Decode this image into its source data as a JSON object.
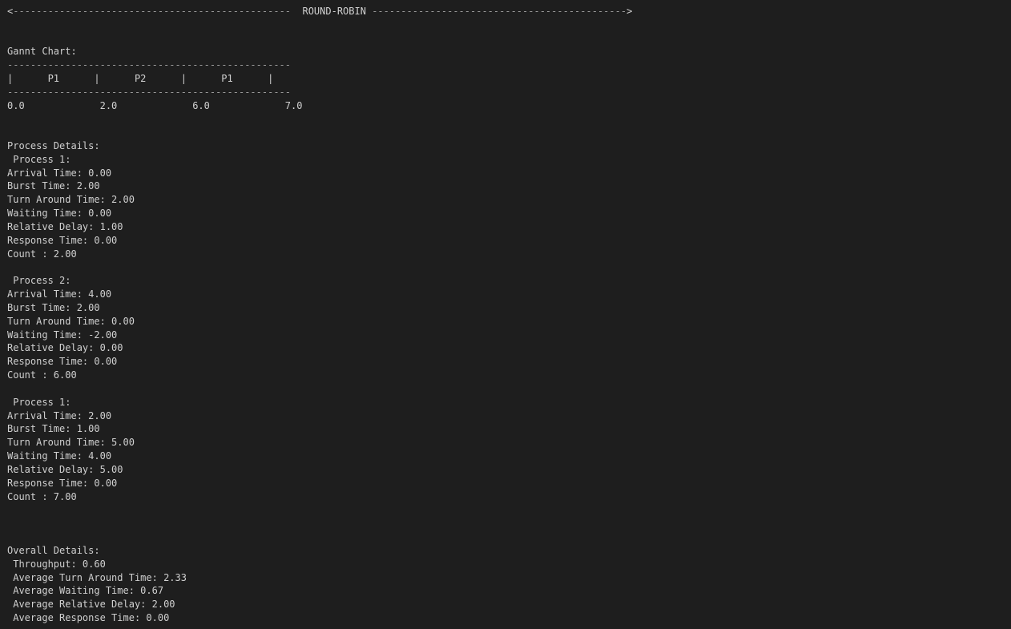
{
  "header": {
    "left_arrow": "<",
    "left_dashes": "------------------------------------------------",
    "title": "ROUND-ROBIN",
    "right_dashes": "--------------------------------------------",
    "right_arrow": ">"
  },
  "gantt": {
    "label": "Gannt Chart:",
    "border_top": "-------------------------------------------------",
    "bar_row": "|      P1      |      P2      |      P1      |",
    "border_bottom": "-------------------------------------------------",
    "times_row": "0.0             2.0             6.0             7.0"
  },
  "process_details": {
    "label": "Process Details:",
    "processes": [
      {
        "heading": " Process 1:",
        "arrival": "Arrival Time: 0.00",
        "burst": "Burst Time: 2.00",
        "turnaround": "Turn Around Time: 2.00",
        "waiting": "Waiting Time: 0.00",
        "relative_delay": "Relative Delay: 1.00",
        "response": "Response Time: 0.00",
        "count": "Count : 2.00"
      },
      {
        "heading": " Process 2:",
        "arrival": "Arrival Time: 4.00",
        "burst": "Burst Time: 2.00",
        "turnaround": "Turn Around Time: 0.00",
        "waiting": "Waiting Time: -2.00",
        "relative_delay": "Relative Delay: 0.00",
        "response": "Response Time: 0.00",
        "count": "Count : 6.00"
      },
      {
        "heading": " Process 1:",
        "arrival": "Arrival Time: 2.00",
        "burst": "Burst Time: 1.00",
        "turnaround": "Turn Around Time: 5.00",
        "waiting": "Waiting Time: 4.00",
        "relative_delay": "Relative Delay: 5.00",
        "response": "Response Time: 0.00",
        "count": "Count : 7.00"
      }
    ]
  },
  "overall": {
    "label": "Overall Details:",
    "throughput": " Throughput: 0.60",
    "avg_turnaround": " Average Turn Around Time: 2.33",
    "avg_waiting": " Average Waiting Time: 0.67",
    "avg_relative_delay": " Average Relative Delay: 2.00",
    "avg_response": " Average Response Time: 0.00"
  }
}
